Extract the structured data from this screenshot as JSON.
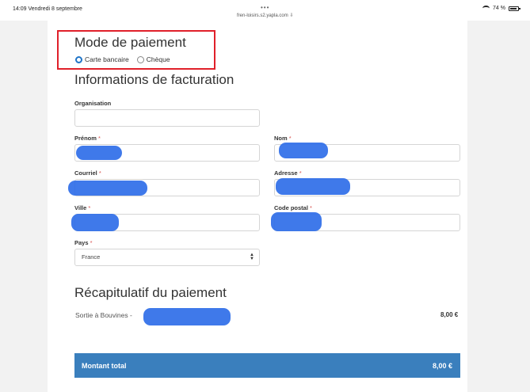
{
  "status_bar": {
    "time_date": "14:09  Vendredi 8 septembre",
    "dots": "•••",
    "url": "fren-loisirs.s2.yapla.com ⇩",
    "battery": "74 %"
  },
  "payment": {
    "title": "Mode de paiement",
    "options": [
      {
        "label": "Carte bancaire",
        "selected": true
      },
      {
        "label": "Chèque",
        "selected": false
      }
    ]
  },
  "billing": {
    "title": "Informations de facturation",
    "required_mark": "*",
    "fields": {
      "organisation": {
        "label": "Organisation",
        "value": ""
      },
      "prenom": {
        "label": "Prénom",
        "value": ""
      },
      "nom": {
        "label": "Nom",
        "value": ""
      },
      "courriel": {
        "label": "Courriel",
        "value": ""
      },
      "adresse": {
        "label": "Adresse",
        "value": ""
      },
      "ville": {
        "label": "Ville",
        "value": ""
      },
      "code_postal": {
        "label": "Code postal",
        "value": ""
      },
      "pays": {
        "label": "Pays",
        "value": "France"
      }
    }
  },
  "recap": {
    "title": "Récapitulatif du paiement",
    "item_label": "Sortie à Bouvines -",
    "item_price": "8,00 €",
    "total_label": "Montant total",
    "total_value": "8,00 €"
  },
  "colors": {
    "accent": "#3a7fbd",
    "highlight_border": "#e0202a",
    "redaction": "#2f6ee8",
    "required": "#d9534f"
  }
}
